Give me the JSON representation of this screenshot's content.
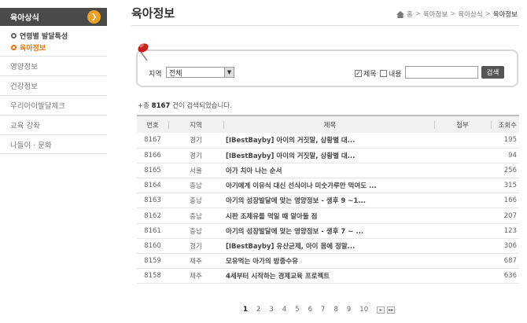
{
  "sidebar": {
    "header": "육아상식",
    "sub_items": [
      {
        "label": "연령별 발달특성",
        "active": false
      },
      {
        "label": "육아정보",
        "active": true
      }
    ],
    "menu": [
      "영양정보",
      "건강정보",
      "우리아이발달체크",
      "교육 강좌",
      "나들이 · 문화"
    ]
  },
  "header": {
    "title": "육아정보",
    "breadcrumb": [
      "홈",
      "육아정보",
      "육아상식",
      "육아정보"
    ]
  },
  "search": {
    "region_label": "지역",
    "region_value": "전체",
    "check_title": "제목",
    "check_content": "내용",
    "title_checked": true,
    "content_checked": false,
    "query": "",
    "button": "검색"
  },
  "result": {
    "prefix": "+총",
    "count": "8167",
    "suffix": "건이 검색되었습니다."
  },
  "table": {
    "headers": {
      "no": "번호",
      "region": "지역",
      "title": "제목",
      "attach": "첨부",
      "views": "조회수"
    },
    "rows": [
      {
        "no": "8167",
        "region": "경기",
        "title": "[IBestBayby] 아이의 거짓말, 상황별 대...",
        "views": "195"
      },
      {
        "no": "8166",
        "region": "경기",
        "title": "[IBestBayby] 아이의 거짓말, 상황별 대...",
        "views": "94"
      },
      {
        "no": "8165",
        "region": "서울",
        "title": "아가 치아 나는 순서",
        "views": "256"
      },
      {
        "no": "8164",
        "region": "충남",
        "title": "아기에게 이유식 대신 선식이나 미숫가루만 먹여도 ...",
        "views": "315"
      },
      {
        "no": "8163",
        "region": "충남",
        "title": "아기의 성장발달에 맞는 영양정보 - 생후 9 ~1...",
        "views": "166"
      },
      {
        "no": "8162",
        "region": "충남",
        "title": "시판 조제유를 먹일 때 알아둘 점",
        "views": "207"
      },
      {
        "no": "8161",
        "region": "충남",
        "title": "아기의 성장발달에 맞는 영양정보 - 생후 7 ~ ...",
        "views": "123"
      },
      {
        "no": "8160",
        "region": "경기",
        "title": "[IBestBayby] 유산균제, 아이 몸에 정말...",
        "views": "306"
      },
      {
        "no": "8159",
        "region": "제주",
        "title": "모유먹는 아가의 방중수유",
        "views": "687"
      },
      {
        "no": "8158",
        "region": "제주",
        "title": "4세부터 시작하는 경제교육 프로젝트",
        "views": "636"
      }
    ]
  },
  "pager": {
    "pages": [
      "1",
      "2",
      "3",
      "4",
      "5",
      "6",
      "7",
      "8",
      "9",
      "10"
    ],
    "current": "1",
    "next": "▸",
    "last": "▸▸"
  },
  "colors": {
    "accent": "#e8750b",
    "sidebar_header": "#4a4a4a"
  }
}
